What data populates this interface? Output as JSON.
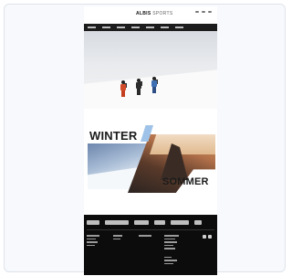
{
  "brand": {
    "name": "ALBIS",
    "suffix": "SPORTS"
  },
  "hero": {
    "hikers": [
      "hiker-red",
      "hiker-dark",
      "hiker-blue"
    ]
  },
  "feature": {
    "winter_label": "WINTER",
    "sommer_label": "SOMMER"
  },
  "colors": {
    "nav": "#1c1c1c",
    "footer": "#0c0c0c",
    "hiker_red": "#d24b2a",
    "hiker_dark": "#2d2d2d",
    "hiker_blue": "#3f6fb3",
    "accent_blue": "#9fc3e8"
  }
}
